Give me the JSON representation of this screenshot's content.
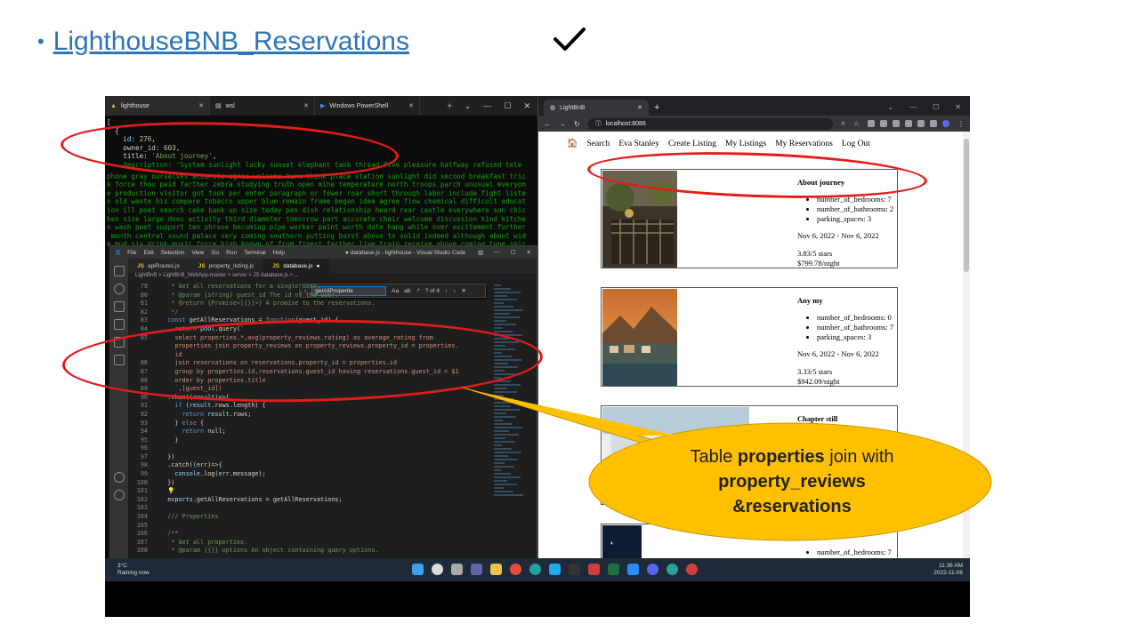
{
  "slide": {
    "bullet": "•",
    "title": "LighthouseBNB_Reservations",
    "check": "✔"
  },
  "terminal": {
    "tabs": [
      {
        "icon": "▲",
        "label": "lighthouse"
      },
      {
        "icon": "▤",
        "label": "wsl"
      },
      {
        "icon": "▶",
        "label": "Windows PowerShell"
      }
    ],
    "lines": [
      "[",
      "  {",
      "    id: 276,",
      "    owner_id: 603,",
      "    title: 'About journey',",
      "    description: 'System sunlight lucky sunset elephant tank thread five pleasure halfway refused tele"
    ],
    "green_lines": [
      "phone gray ourselves accurate agree welcome turn think place station sunlight did second breakfast tric",
      "k force thou paid farther zebra studying truth open mine temperature north troops parch unusual everyon",
      "e production visitor got took per enter paragraph or fewer roar short through labor include fight liste",
      "n old waste his compare tobacco upper blue remain frame began idea agree flow chemical difficult educat",
      "ion ill poet search cake bank up size today pen dish relationship heard rear castle everywhere son chic",
      "ken size large does activity third diameter tomorrow part accurate chair welcome discussion kind kitche",
      "n wash poet support ten phrase becoming pipe worker paint worth date hang while over excitement further",
      " month central sound palace very coming southern putting burst above to solid indeed although about wid",
      "e mud six drink music force high known of from finest farther live train receive above coming tune spir"
    ]
  },
  "vscode": {
    "menu": [
      "File",
      "Edit",
      "Selection",
      "View",
      "Go",
      "Run",
      "Terminal",
      "Help"
    ],
    "title": "● database.js - lighthouse - Visual Studio Code",
    "tabs": [
      "apiRoutes.js",
      "property_listing.js",
      "database.js"
    ],
    "breadcrumb": "LightBnB > LightBnB_WebApp-master > server > JS database.js > ...",
    "find": {
      "value": "getAllPropertie",
      "count": "? of 4"
    },
    "code": [
      {
        "n": "79",
        "t": "   * Get all reservations for a single user."
      },
      {
        "n": "80",
        "t": "   * @param {string} guest_id The id of the user."
      },
      {
        "n": "81",
        "t": "   * @return {Promise<[{}]>} A promise to the reservations."
      },
      {
        "n": "82",
        "t": "   */"
      },
      {
        "n": "83",
        "t": "  const getAllReservations = function(guest_id) {"
      },
      {
        "n": "84",
        "t": "    return pool.query(`"
      },
      {
        "n": "85",
        "t": "    select properties.*,avg(property_reviews.rating) as average_rating from"
      },
      {
        "n": "",
        "t": "    properties join property_reviews on property_reviews.property_id = properties."
      },
      {
        "n": "",
        "t": "    id"
      },
      {
        "n": "86",
        "t": "    join reservations on reservations.property_id = properties.id"
      },
      {
        "n": "87",
        "t": "    group by properties.id,reservations.guest_id having reservations.guest_id = $1"
      },
      {
        "n": "88",
        "t": "    order by properties.title"
      },
      {
        "n": "89",
        "t": "    `,[guest_id])"
      },
      {
        "n": "90",
        "t": "  .then((result)=>{"
      },
      {
        "n": "91",
        "t": "    if (result.rows.length) {"
      },
      {
        "n": "92",
        "t": "      return result.rows;"
      },
      {
        "n": "93",
        "t": "    } else {"
      },
      {
        "n": "94",
        "t": "      return null;"
      },
      {
        "n": "95",
        "t": "    }"
      },
      {
        "n": "96",
        "t": ""
      },
      {
        "n": "97",
        "t": "  })"
      },
      {
        "n": "98",
        "t": "  .catch((err)=>{"
      },
      {
        "n": "99",
        "t": "    console.log(err.message);"
      },
      {
        "n": "100",
        "t": "  })"
      },
      {
        "n": "101",
        "t": "  💡"
      },
      {
        "n": "102",
        "t": "  exports.getAllReservations = getAllReservations;"
      },
      {
        "n": "103",
        "t": ""
      },
      {
        "n": "104",
        "t": "  /// Properties"
      },
      {
        "n": "105",
        "t": ""
      },
      {
        "n": "106",
        "t": "  /**"
      },
      {
        "n": "107",
        "t": "   * Get all properties."
      },
      {
        "n": "108",
        "t": "   * @param {{}} options An object containing query options."
      }
    ]
  },
  "browser": {
    "tab_label": "LightBnB",
    "url": "localhost:8086",
    "nav": [
      "Search",
      "Eva Stanley",
      "Create Listing",
      "My Listings",
      "My Reservations",
      "Log Out"
    ],
    "cards": [
      {
        "title": "About journey",
        "details": [
          "number_of_bedrooms: 7",
          "number_of_bathrooms: 2",
          "parking_spaces: 3"
        ],
        "dates": "Nov 6, 2022 - Nov 6, 2022",
        "rating": "3.83/5 stars",
        "price": "$799.78/night"
      },
      {
        "title": "Any my",
        "details": [
          "number_of_bedrooms: 0",
          "number_of_bathrooms: 7",
          "parking_spaces: 3"
        ],
        "dates": "Nov 6, 2022 - Nov 6, 2022",
        "rating": "3.33/5 stars",
        "price": "$942.09/night"
      },
      {
        "title": "Chapter still",
        "details": [],
        "dates": "",
        "rating": "",
        "price": ""
      },
      {
        "title": "",
        "details": [
          "number_of_bedrooms: 7"
        ],
        "dates": "",
        "rating": "",
        "price": ""
      }
    ]
  },
  "taskbar": {
    "temp": "3°C",
    "weather": "Raining now",
    "time": "11:36 AM",
    "date": "2022-11-06"
  },
  "callout": {
    "line1_pre": "Table ",
    "line1_bold": "properties",
    "line1_post": " join with",
    "line2": "property_reviews",
    "line3": "&reservations"
  },
  "colors": {
    "title_link": "#2E75B6",
    "ellipse": "#e31c1c",
    "callout_fill": "#FFC000"
  }
}
